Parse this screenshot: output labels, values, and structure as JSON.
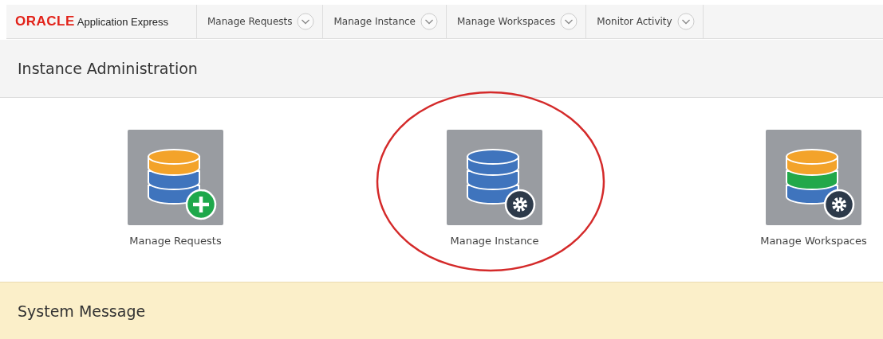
{
  "brand": {
    "logo": "ORACLE",
    "product": "Application Express"
  },
  "nav": [
    {
      "label": "Manage Requests"
    },
    {
      "label": "Manage Instance"
    },
    {
      "label": "Manage Workspaces"
    },
    {
      "label": "Monitor Activity"
    }
  ],
  "page_title": "Instance Administration",
  "tiles": [
    {
      "label": "Manage Requests",
      "kind": "requests",
      "highlighted": false
    },
    {
      "label": "Manage Instance",
      "kind": "instance",
      "highlighted": true
    },
    {
      "label": "Manage Workspaces",
      "kind": "workspaces",
      "highlighted": false
    }
  ],
  "system_message": {
    "title": "System Message"
  }
}
